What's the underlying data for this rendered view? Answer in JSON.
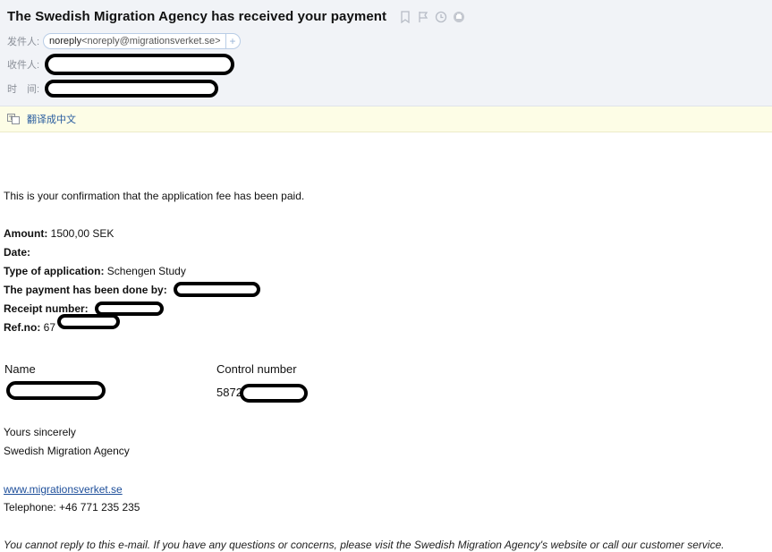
{
  "header": {
    "subject": "The Swedish Migration Agency has received your payment",
    "icons": [
      "bookmark-icon",
      "flag-icon",
      "clock-icon",
      "print-icon"
    ],
    "from_label": "发件人:",
    "sender_name": "noreply",
    "sender_email": "<noreply@migrationsverket.se>",
    "add_symbol": "+",
    "to_label": "收件人:",
    "time_label": "时　间:"
  },
  "translate": {
    "link": "翻译成中文"
  },
  "email": {
    "intro": "This is your confirmation that the application fee has been paid.",
    "amount_label": "Amount:",
    "amount_value": " 1500,00 SEK",
    "date_label": "Date:",
    "type_label": "Type of application:",
    "type_value": " Schengen Study",
    "payment_label": "The payment has been done by:",
    "receipt_label": "Receipt number:",
    "ref_label": "Ref.no:",
    "ref_value": " 67",
    "table": {
      "col_name": "Name",
      "col_control": "Control number",
      "control_value": "5872"
    },
    "closing": "Yours sincerely",
    "signature": "Swedish Migration Agency",
    "website": "www.migrationsverket.se",
    "telephone": "Telephone: +46 771 235 235",
    "note": "You cannot reply to this e-mail. If you have any questions or concerns, please visit the Swedish Migration Agency's website or call our customer service."
  }
}
